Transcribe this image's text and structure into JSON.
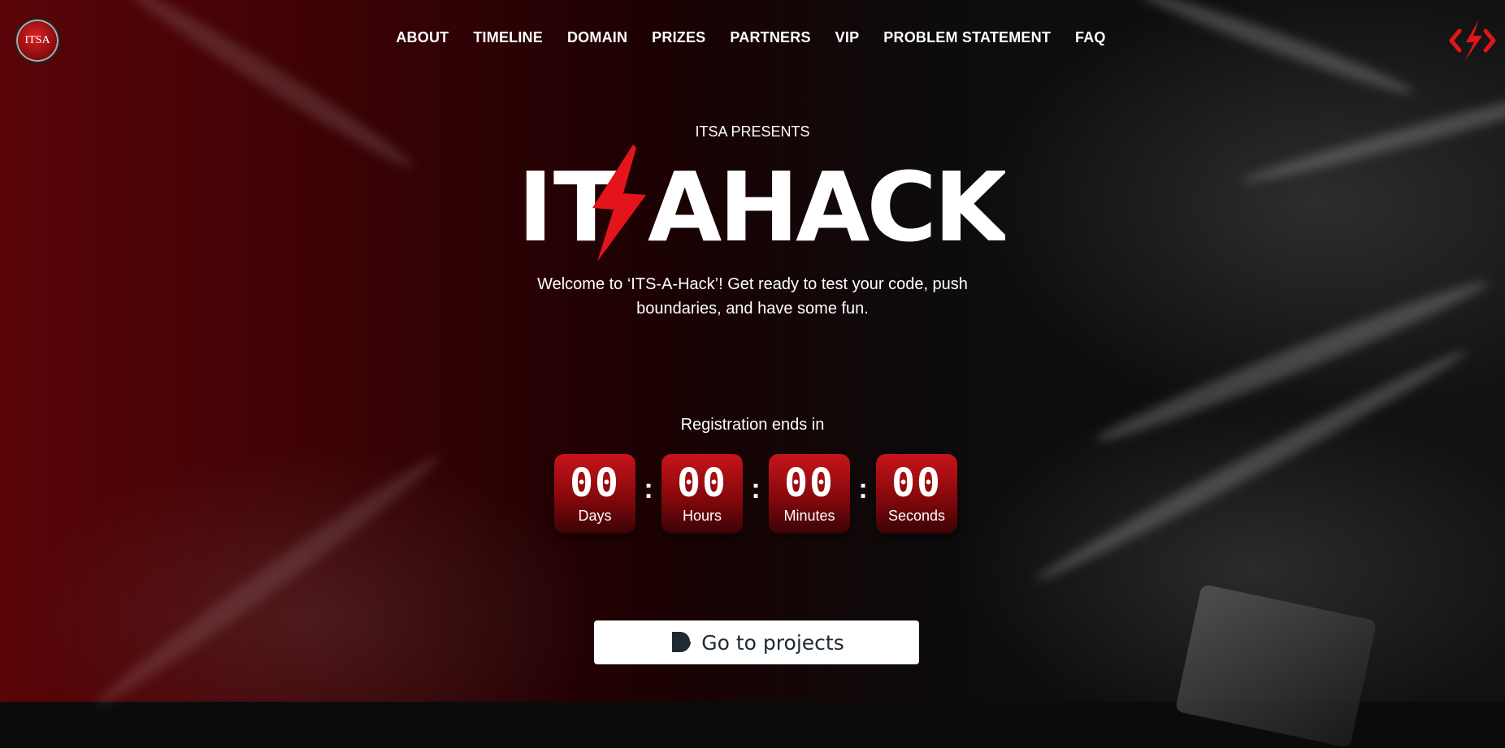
{
  "brand": {
    "logo_text": "ITSA"
  },
  "nav": {
    "items": [
      "ABOUT",
      "TIMELINE",
      "DOMAIN",
      "PRIZES",
      "PARTNERS",
      "VIP",
      "PROBLEM STATEMENT",
      "FAQ"
    ]
  },
  "hero": {
    "presents": "ITSA PRESENTS",
    "title_left": "IT",
    "title_right": "AHACK",
    "tagline_line1": "Welcome to ‘ITS-A-Hack’! Get ready to test your code, push",
    "tagline_line2": "boundaries, and have some fun."
  },
  "countdown": {
    "heading": "Registration ends in",
    "separator": ":",
    "units": [
      {
        "value": "00",
        "label": "Days"
      },
      {
        "value": "00",
        "label": "Hours"
      },
      {
        "value": "00",
        "label": "Minutes"
      },
      {
        "value": "00",
        "label": "Seconds"
      }
    ]
  },
  "cta": {
    "label": "Go to projects",
    "icon": "devfolio-icon"
  },
  "colors": {
    "accent": "#e3151b",
    "background": "#0b0b0c",
    "button_text": "#1f2a33"
  }
}
